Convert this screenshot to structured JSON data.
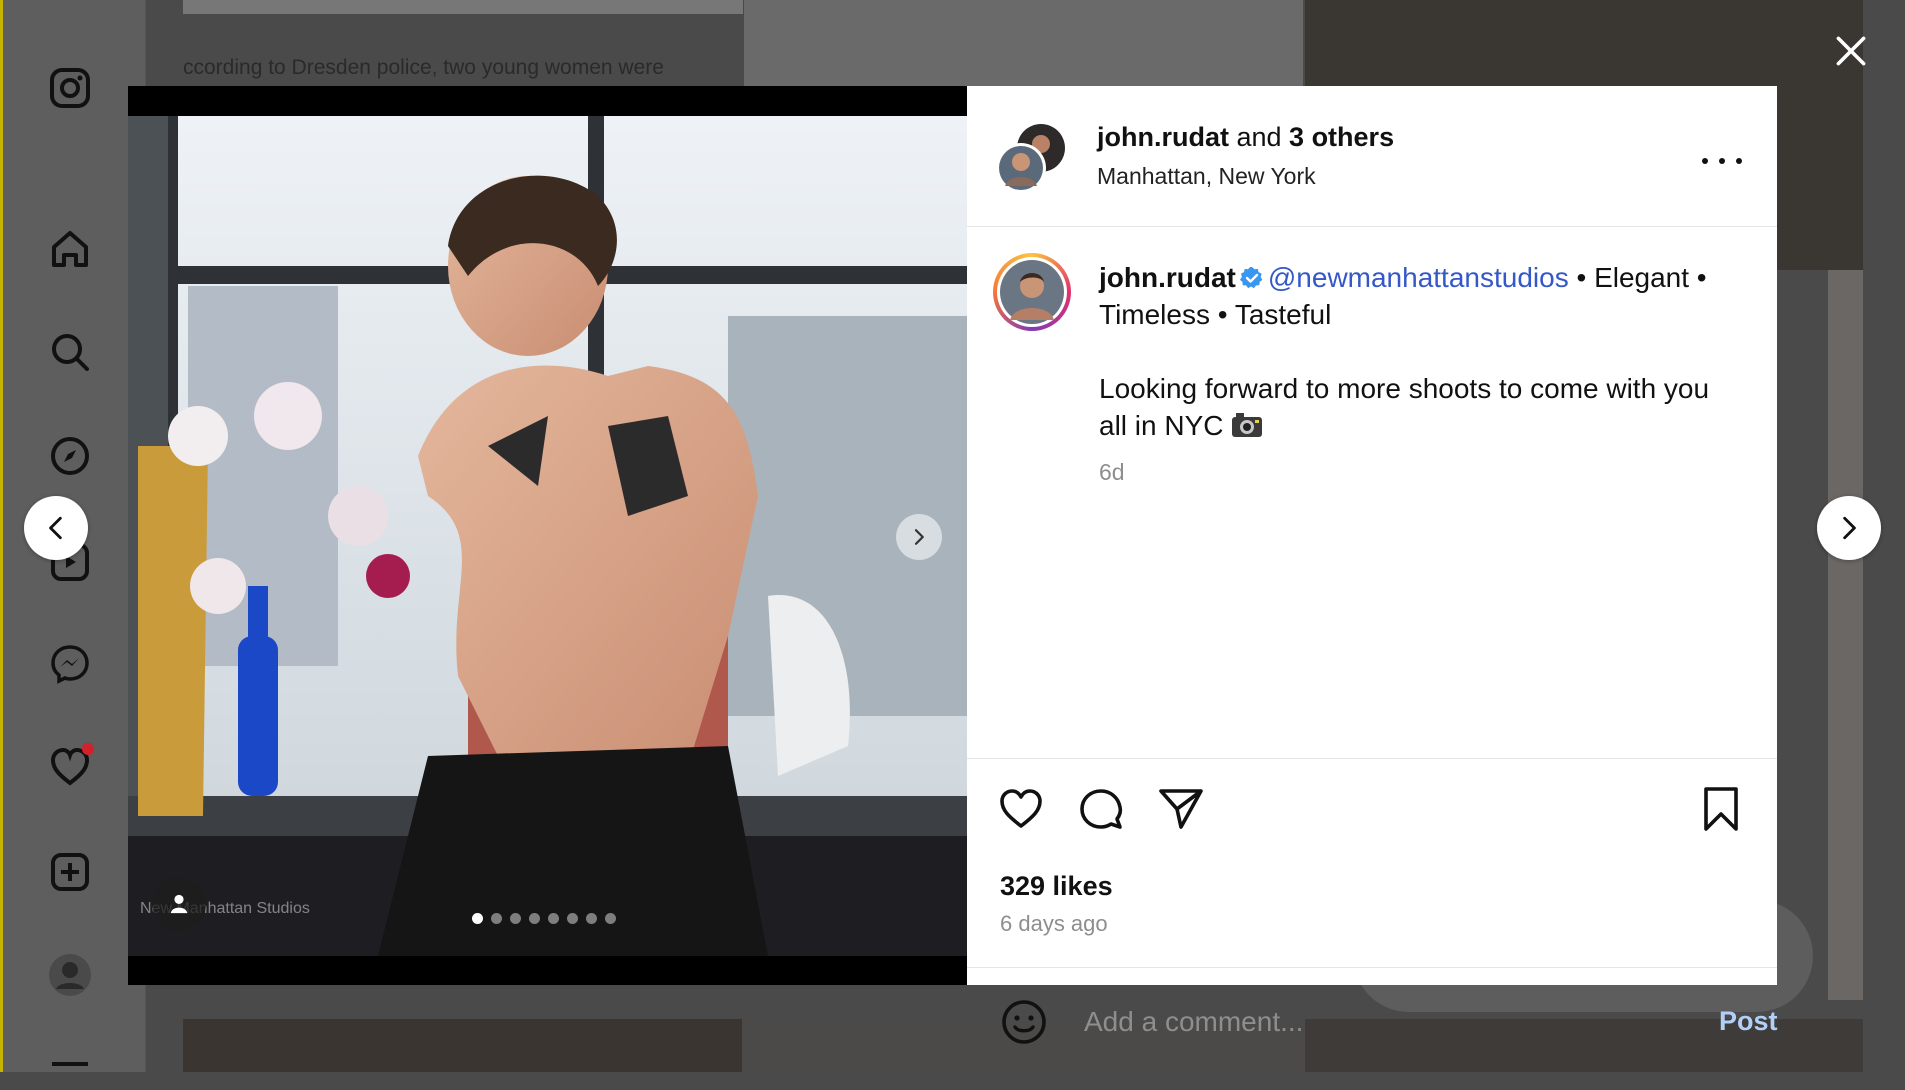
{
  "window": {
    "close_icon": "close-icon"
  },
  "background": {
    "article_snippet": "ccording to Dresden police, two young women were"
  },
  "sidebar": {
    "items": [
      {
        "name": "instagram-logo-icon"
      },
      {
        "name": "home-icon"
      },
      {
        "name": "search-icon"
      },
      {
        "name": "explore-icon"
      },
      {
        "name": "reels-icon"
      },
      {
        "name": "messenger-icon"
      },
      {
        "name": "notifications-heart-icon"
      },
      {
        "name": "create-icon"
      },
      {
        "name": "profile-avatar"
      },
      {
        "name": "more-menu-icon"
      }
    ]
  },
  "post": {
    "header": {
      "username": "john.rudat",
      "and_text": " and ",
      "others": "3 others",
      "location": "Manhattan, New York"
    },
    "media": {
      "watermark": "New Manhattan Studios",
      "slide_count": 8,
      "active_slide": 1
    },
    "caption": {
      "username": "john.rudat",
      "mention": "@newmanhattanstudios",
      "line1_rest": " • Elegant • Timeless • Tasteful",
      "body": "Looking forward to more shoots to come with you all in NYC",
      "time": "6d"
    },
    "likes": "329 likes",
    "posted_ago": "6 days ago",
    "comment": {
      "placeholder": "Add a comment...",
      "post_label": "Post"
    }
  },
  "colors": {
    "accent_link": "#3558c8",
    "post_disabled": "#b2cff8",
    "notification_dot": "#d2202c",
    "verified": "#3897f0"
  }
}
